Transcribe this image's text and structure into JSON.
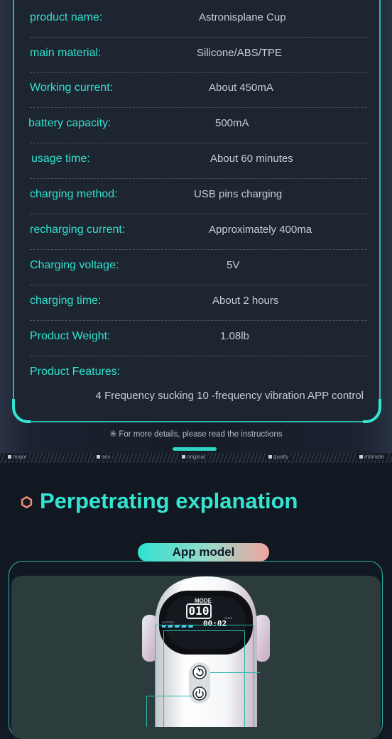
{
  "specs": [
    {
      "label": "product name:",
      "value": "Astronisplane Cup"
    },
    {
      "label": "main material:",
      "value": "Silicone/ABS/TPE"
    },
    {
      "label": "Working current:",
      "value": "About 450mA"
    },
    {
      "label": "battery capacity:",
      "value": "500mA"
    },
    {
      "label": "usage time:",
      "value": "About 60 minutes"
    },
    {
      "label": "charging method:",
      "value": "USB pins charging"
    },
    {
      "label": "recharging current:",
      "value": "Approximately 400ma"
    },
    {
      "label": "Charging voltage:",
      "value": "5V"
    },
    {
      "label": "charging time:",
      "value": "About 2 hours"
    },
    {
      "label": "Product Weight:",
      "value": "1.08lb"
    },
    {
      "label": "Product Features:",
      "value": "4 Frequency sucking 10 -frequency vibration APP control"
    }
  ],
  "footnote": "※ For more details, please read the instructions",
  "ticker": [
    "major",
    "sex",
    "original",
    "qualty",
    "intimate"
  ],
  "section": {
    "heading": "Perpetrating explanation",
    "pill": "App model"
  },
  "device": {
    "mode_label": "MODE",
    "mode_value": "010",
    "time_value": "00:02",
    "battery_label": "BATTERY",
    "time_label": "TIMES"
  },
  "colors": {
    "accent": "#31e0cf",
    "pill_end": "#f0a3a0",
    "hex_icon": "#f08a78"
  }
}
